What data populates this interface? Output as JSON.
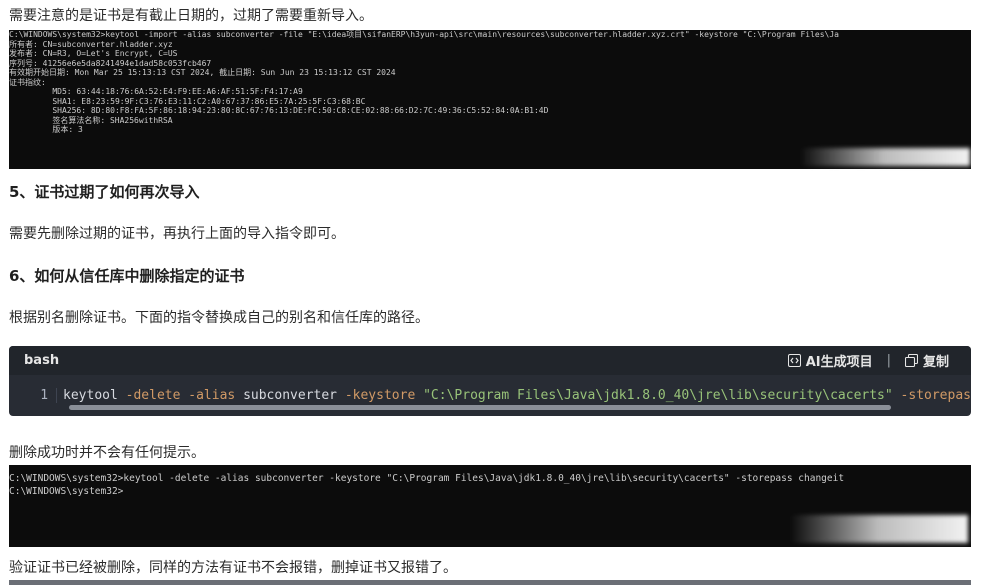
{
  "para1": "需要注意的是证书是有截止日期的，过期了需要重新导入。",
  "term1": {
    "lines": [
      "C:\\WINDOWS\\system32>keytool -import -alias subconverter -file \"E:\\idea项目\\sifanERP\\h3yun-api\\src\\main\\resources\\subconverter.hladder.xyz.crt\" -keystore \"C:\\Program Files\\Ja",
      "所有者: CN=subconverter.hladder.xyz",
      "发布者: CN=R3, O=Let's Encrypt, C=US",
      "序列号: 41256e6e5da8241494e1dad58c053fcb467",
      "有效期开始日期: Mon Mar 25 15:13:13 CST 2024, 截止日期: Sun Jun 23 15:13:12 CST 2024",
      "证书指纹:",
      "         MD5: 63:44:18:76:6A:52:E4:F9:EE:A6:AF:51:5F:F4:17:A9",
      "         SHA1: E8:23:59:9F:C3:76:E3:11:C2:A0:67:37:86:E5:7A:25:5F:C3:68:BC",
      "         SHA256: 8D:80:F8:FA:5F:86:18:94:23:80:8C:67:76:13:DE:FC:50:C8:CE:02:88:66:D2:7C:49:36:C5:52:84:0A:B1:4D",
      "         签名算法名称: SHA256withRSA",
      "         版本: 3"
    ]
  },
  "heading5": "5、证书过期了如何再次导入",
  "para2": "需要先删除过期的证书，再执行上面的导入指令即可。",
  "heading6": "6、如何从信任库中删除指定的证书",
  "para3": "根据别名删除证书。下面的指令替换成自己的别名和信任库的路径。",
  "codeblock": {
    "lang": "bash",
    "ai_label": "AI生成项目",
    "copy_label": "复制",
    "separator": "|",
    "line_number": "1",
    "tokens": {
      "cmd": "keytool",
      "flag_delete": "-delete",
      "flag_alias": "-alias",
      "alias": "subconverter",
      "flag_keystore": "-keystore",
      "path": "\"C:\\Program Files\\Java\\jdk1.8.0_40\\jre\\lib\\security\\cacerts\"",
      "flag_storepass": "-storepas"
    }
  },
  "para4": "删除成功时并不会有任何提示。",
  "term2": {
    "lines": [
      "C:\\WINDOWS\\system32>keytool -delete -alias subconverter -keystore \"C:\\Program Files\\Java\\jdk1.8.0_40\\jre\\lib\\security\\cacerts\" -storepass changeit",
      "",
      "C:\\WINDOWS\\system32>"
    ]
  },
  "para5": "验证证书已经被删除，同样的方法有证书不会报错，删掉证书又报错了。"
}
